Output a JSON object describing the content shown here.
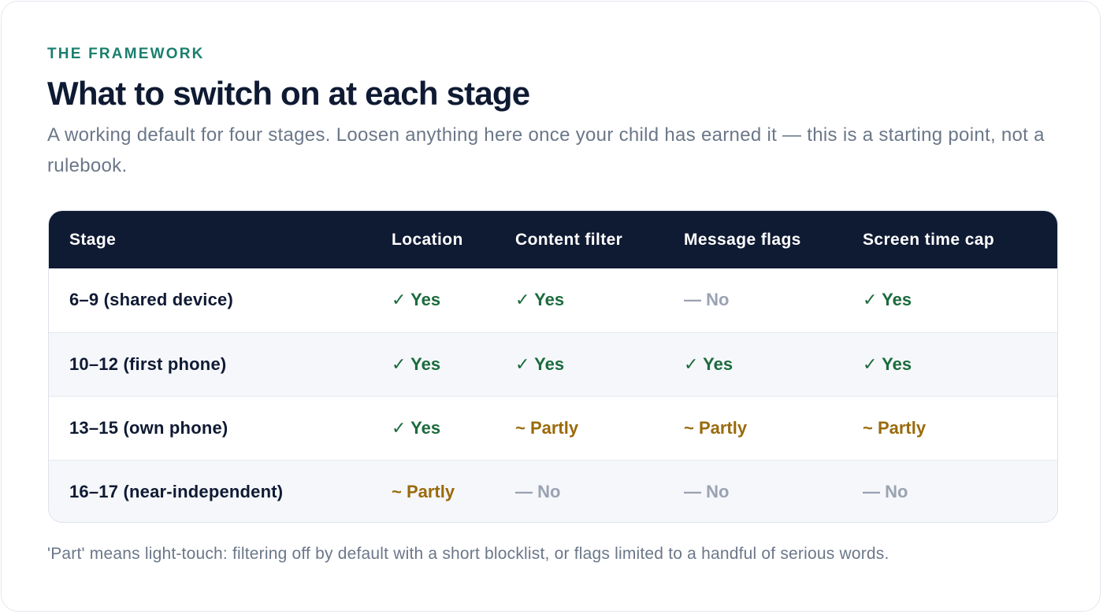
{
  "eyebrow": "THE FRAMEWORK",
  "title": "What to switch on at each stage",
  "subtitle": "A working default for four stages. Loosen anything here once your child has earned it — this is a starting point, not a rulebook.",
  "table": {
    "headers": [
      "Stage",
      "Location",
      "Content filter",
      "Message flags",
      "Screen time cap"
    ],
    "rows": [
      {
        "stage": "6–9 (shared device)",
        "cells": [
          {
            "text": "✓ Yes",
            "status": "yes"
          },
          {
            "text": "✓ Yes",
            "status": "yes"
          },
          {
            "text": "— No",
            "status": "no"
          },
          {
            "text": "✓ Yes",
            "status": "yes"
          }
        ]
      },
      {
        "stage": "10–12 (first phone)",
        "cells": [
          {
            "text": "✓ Yes",
            "status": "yes"
          },
          {
            "text": "✓ Yes",
            "status": "yes"
          },
          {
            "text": "✓ Yes",
            "status": "yes"
          },
          {
            "text": "✓ Yes",
            "status": "yes"
          }
        ]
      },
      {
        "stage": "13–15 (own phone)",
        "cells": [
          {
            "text": "✓ Yes",
            "status": "yes"
          },
          {
            "text": "~ Partly",
            "status": "partly"
          },
          {
            "text": "~ Partly",
            "status": "partly"
          },
          {
            "text": "~ Partly",
            "status": "partly"
          }
        ]
      },
      {
        "stage": "16–17 (near-independent)",
        "cells": [
          {
            "text": "~ Partly",
            "status": "partly"
          },
          {
            "text": "— No",
            "status": "no"
          },
          {
            "text": "— No",
            "status": "no"
          },
          {
            "text": "— No",
            "status": "no"
          }
        ]
      }
    ]
  },
  "footnote": "'Part' means light-touch: filtering off by default with a short blocklist, or flags limited to a handful of serious words.",
  "colors": {
    "accent": "#1a7f6e",
    "header_bg": "#0f1a33",
    "yes": "#1b6b3d",
    "partly": "#9a6a0b",
    "no": "#9aa3b2"
  }
}
